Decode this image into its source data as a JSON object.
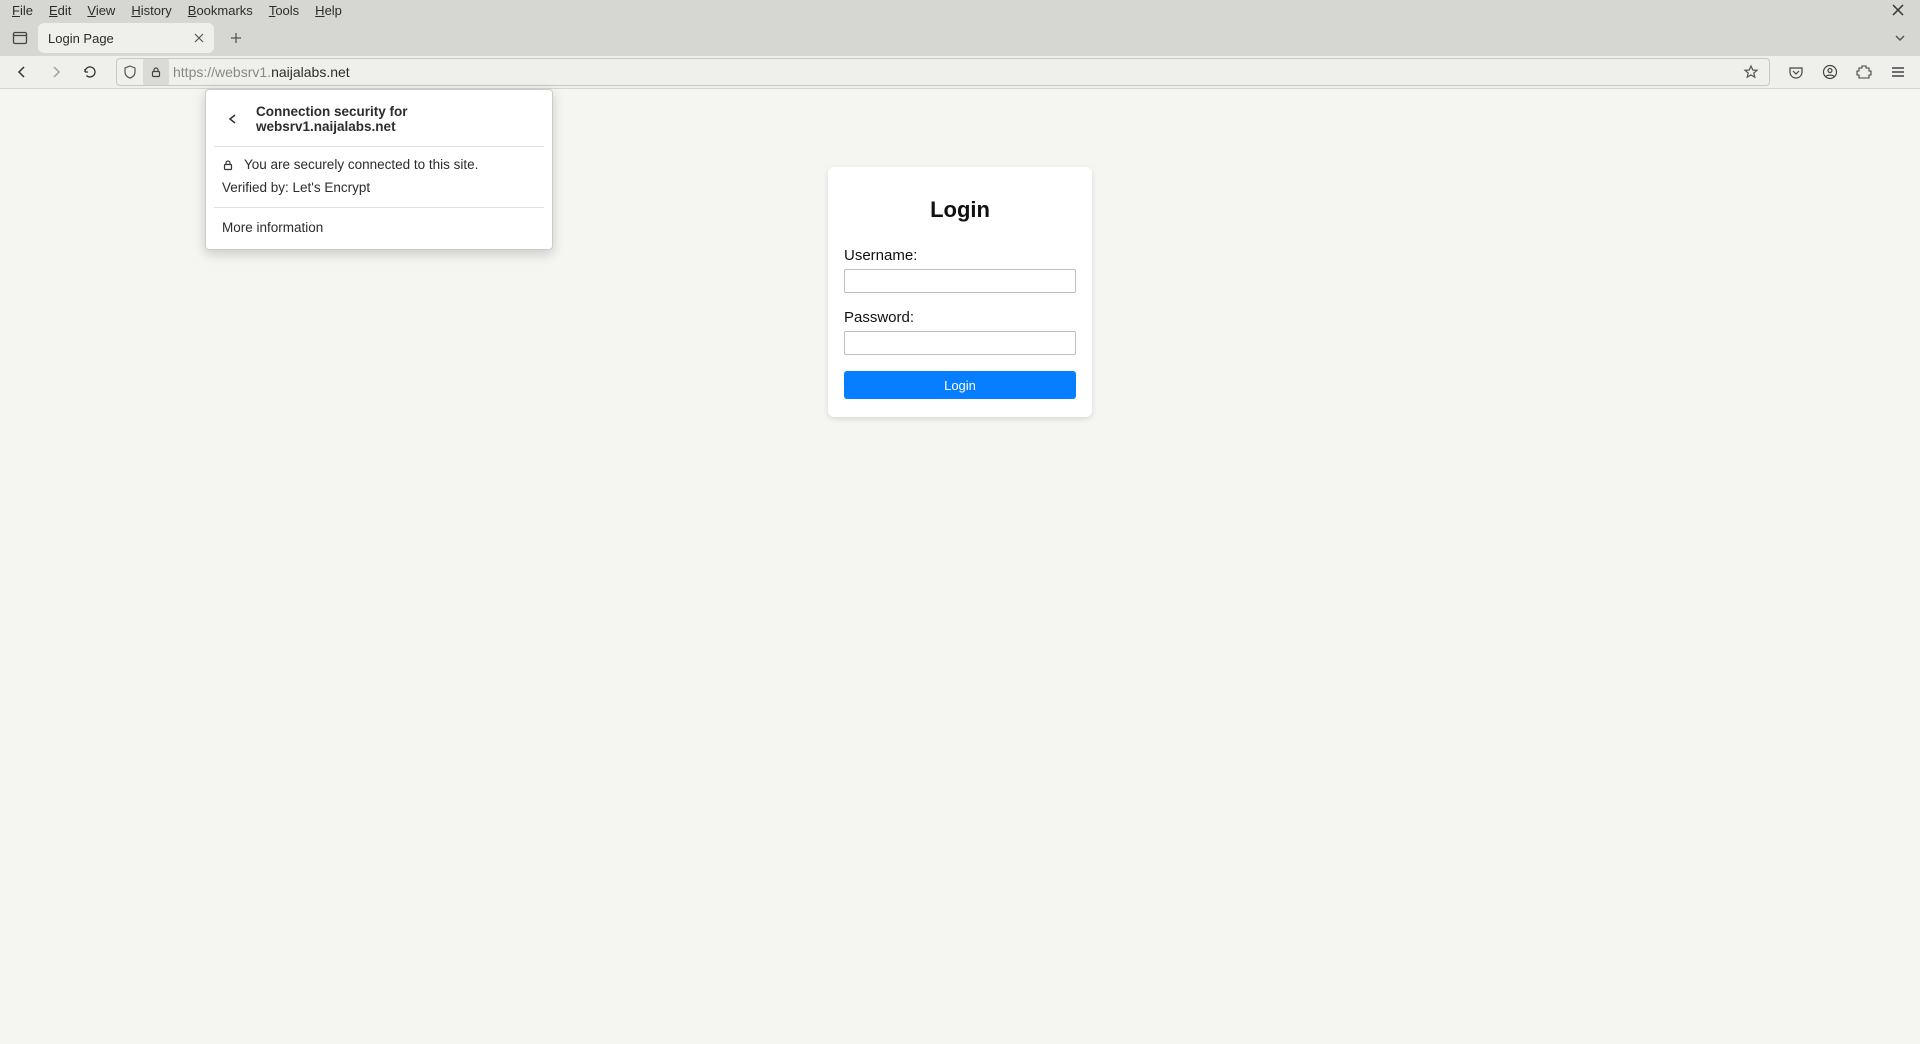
{
  "menubar": {
    "items": [
      {
        "label": "File",
        "underline": "F"
      },
      {
        "label": "Edit",
        "underline": "E"
      },
      {
        "label": "View",
        "underline": "V"
      },
      {
        "label": "History",
        "underline": "H"
      },
      {
        "label": "Bookmarks",
        "underline": "B"
      },
      {
        "label": "Tools",
        "underline": "T"
      },
      {
        "label": "Help",
        "underline": "H"
      }
    ]
  },
  "tabstrip": {
    "tab_title": "Login Page"
  },
  "addressbar": {
    "protocol": "https://",
    "subdomain": "websrv1.",
    "domain": "naijalabs.net"
  },
  "security_popover": {
    "title": "Connection security for websrv1.naijalabs.net",
    "secure_message": "You are securely connected to this site.",
    "verified_by": "Verified by: Let's Encrypt",
    "more_info": "More information"
  },
  "login": {
    "title": "Login",
    "username_label": "Username:",
    "password_label": "Password:",
    "button": "Login"
  }
}
